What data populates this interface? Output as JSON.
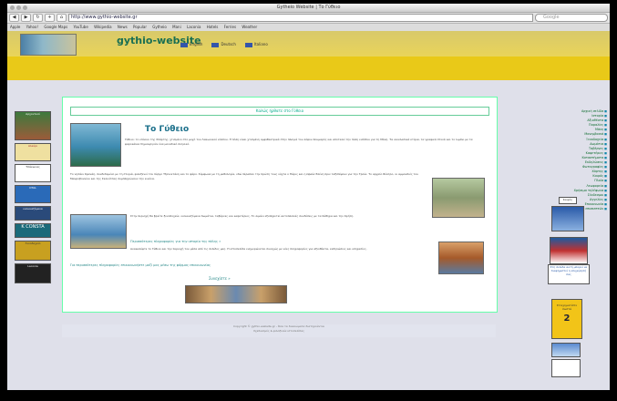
{
  "browser": {
    "window_title": "Gytheio Website | Το Γύθειο",
    "url": "http://www.gythio-website.gr",
    "search_placeholder": "Google",
    "nav_buttons": [
      "◀",
      "▶",
      "↻",
      "+",
      "⌂"
    ],
    "bookmarks": [
      "Apple",
      "Yahoo!",
      "Google Maps",
      "YouTube",
      "Wikipedia",
      "News",
      "Popular",
      "Gytheio",
      "Mani",
      "Laconia",
      "Hotels",
      "Ferries",
      "Weather"
    ]
  },
  "site": {
    "title": "gythio-website",
    "languages": [
      "English",
      "Deutsch",
      "Italiano"
    ]
  },
  "main": {
    "breadcrumb": "Καλώς ήρθατε στο Γύθειο",
    "heading": "Το Γύθειο",
    "paragraph1": "Γύθειο: το επίνειο της Σπάρτης, χτισμένο στο μυχό του Λακωνικού κόλπου. Η πόλη είναι χτισμένη αμφιθεατρικά στην πλαγιά του λόφου Κουμαρός και αποτελεί την πύλη εισόδου για τη Μάνη. Τα νεοκλασικά κτίρια, τα γραφικά στενά και το λιμάνι με τα ψαροκάικα δημιουργούν ένα μοναδικό σκηνικό.",
    "paragraph2": "Το νησάκι Κρανάη, συνδεδεμένο με τη στεριά, φιλοξενεί τον πύργο Τζαννετάκη και το φάρο. Σύμφωνα με τη μυθολογία, εδώ πέρασαν την πρώτη τους νύχτα ο Πάρις και η Ωραία Ελένη πριν ταξιδέψουν για την Τροία. Το αρχαίο θέατρο, οι αμμουδιές του Μαυροβουνίου και της Σελινίτσας συμπληρώνουν την εικόνα.",
    "paragraph3": "Στην περιοχή θα βρείτε ξενοδοχεία, ενοικιαζόμενα δωμάτια, ταβέρνες και καφετέριες. Το λιμάνι εξυπηρετεί ακτοπλοϊκές συνδέσεις με τα Κύθηρα και την Κρήτη.",
    "paragraph4": "Ανακαλύψτε το Γύθειο και την περιοχή του μέσα από τις σελίδες μας. Η ιστοσελίδα ενημερώνεται συνεχώς με νέες πληροφορίες για αξιοθέατα, εκδηλώσεις και υπηρεσίες.",
    "link1": "Περισσότερες πληροφορίες για την ιστορία της πόλης »",
    "link2": "Για περισσότερες πληροφορίες επικοινωνήστε μαζί μας μέσω της φόρμας επικοινωνίας",
    "more_label": "Συνεχίστε »"
  },
  "left_ads": [
    "Αρχοντικό",
    "Αλεύρι",
    "Τσάκωνας",
    "OTAL",
    "ενοικιαζόμενα",
    "K CONSTA",
    "Ξενοδοχείο",
    "Laconia"
  ],
  "right_nav": [
    "Αρχική σελίδα",
    "Ιστορία",
    "Αξιοθέατα",
    "Παραλίες",
    "Μάνη",
    "Μονεμβασιά",
    "Ξενοδοχεία",
    "Δωμάτια",
    "Ταβέρνες",
    "Καφετέριες",
    "Καταστήματα",
    "Εκδηλώσεις",
    "Φωτογραφίες",
    "Χάρτης",
    "Καιρός",
    "Πλοία",
    "Λεωφορεία",
    "Χρήσιμα τηλέφωνα",
    "Σύνδεσμοι",
    "Αγγελίες",
    "Επικοινωνία",
    "Βιβλίο επισκεπτών"
  ],
  "right_boxes": {
    "weather_label": "Καιρός",
    "ad_text": "Στη σελίδα αυτή μπορεί να διαφημιστεί η επιχείρησή σας",
    "lottery_text": "Στοιχηματίστε σωστά",
    "lottery_number": "2"
  },
  "footer": {
    "line1": "Copyright © gythio-website.gr - Όλα τα δικαιώματα διατηρούνται",
    "line2": "Σχεδιασμός & φιλοξενία ιστοσελίδας"
  }
}
